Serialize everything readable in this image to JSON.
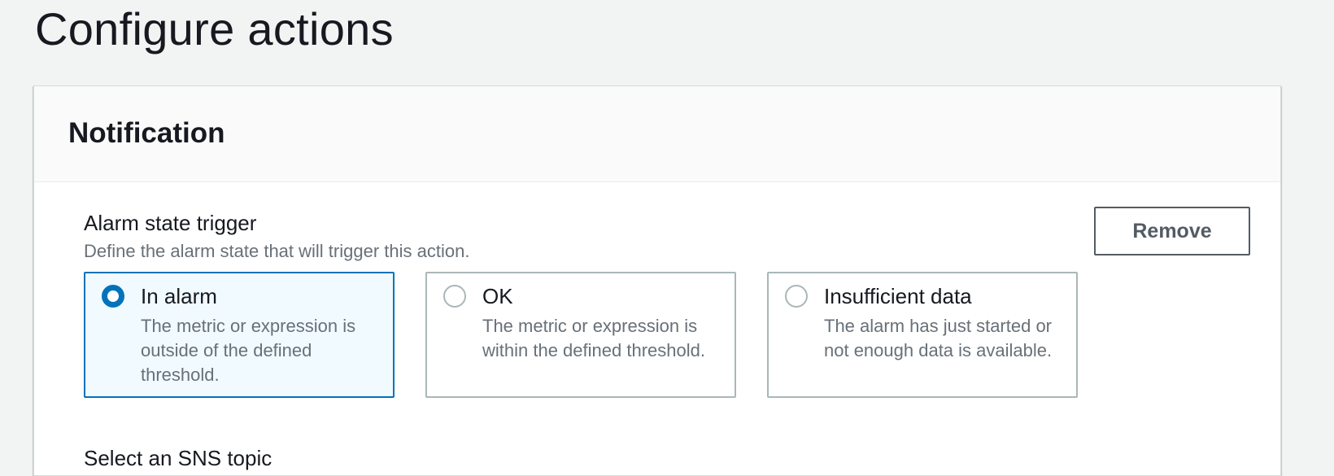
{
  "page": {
    "title": "Configure actions"
  },
  "notification": {
    "title": "Notification",
    "trigger_label": "Alarm state trigger",
    "trigger_description": "Define the alarm state that will trigger this action.",
    "remove_label": "Remove",
    "options": [
      {
        "label": "In alarm",
        "description": "The metric or expression is outside of the defined threshold.",
        "selected": true
      },
      {
        "label": "OK",
        "description": "The metric or expression is within the defined threshold.",
        "selected": false
      },
      {
        "label": "Insufficient data",
        "description": "The alarm has just started or not enough data is available.",
        "selected": false
      }
    ],
    "next_section_label": "Select an SNS topic"
  },
  "colors": {
    "accent": "#0073bb",
    "selected_background": "#f1faff",
    "page_background": "#f2f3f3",
    "border": "#aab7b8",
    "secondary_text": "#687078"
  },
  "icons": {
    "radio_checked": "radio-checked-icon",
    "radio_unchecked": "radio-unchecked-icon"
  }
}
